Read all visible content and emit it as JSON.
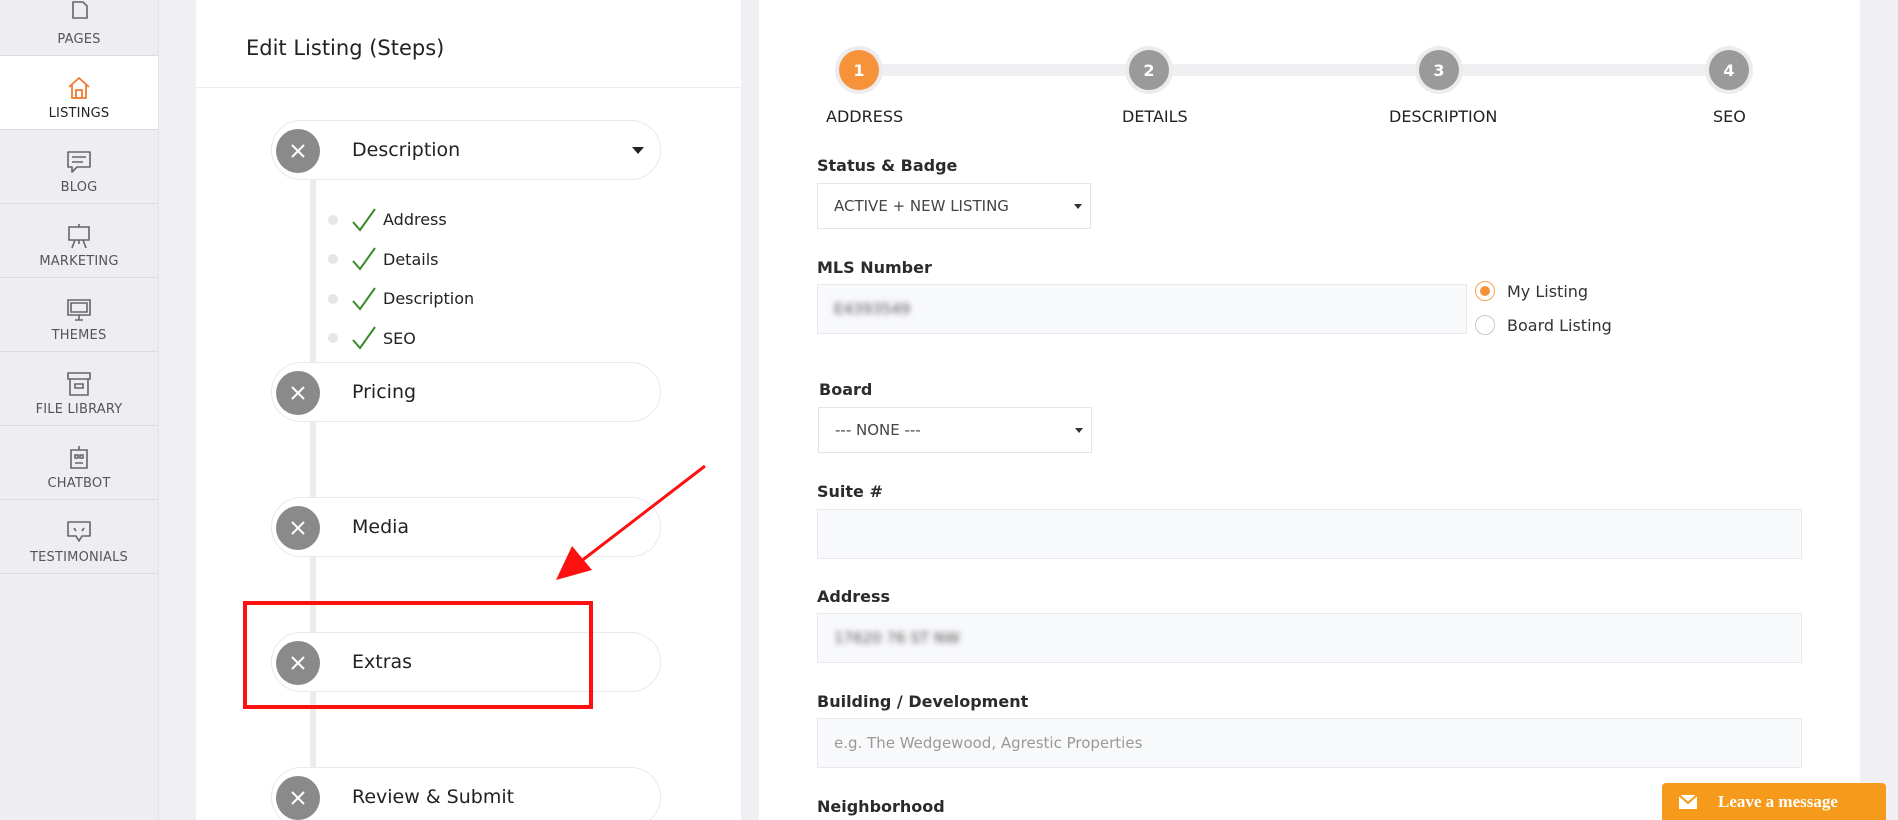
{
  "sidebar": {
    "items": [
      {
        "label": "PAGES",
        "icon": "page-icon"
      },
      {
        "label": "LISTINGS",
        "icon": "house-icon",
        "active": true
      },
      {
        "label": "BLOG",
        "icon": "comment-icon"
      },
      {
        "label": "MARKETING",
        "icon": "easel-icon"
      },
      {
        "label": "THEMES",
        "icon": "monitor-icon"
      },
      {
        "label": "FILE LIBRARY",
        "icon": "archive-icon"
      },
      {
        "label": "CHATBOT",
        "icon": "robot-icon"
      },
      {
        "label": "TESTIMONIALS",
        "icon": "testimonial-icon"
      }
    ],
    "accent_color": "#f07a2e"
  },
  "steps_panel": {
    "title": "Edit Listing (Steps)",
    "steps": [
      {
        "label": "Description"
      },
      {
        "label": "Pricing"
      },
      {
        "label": "Media"
      },
      {
        "label": "Extras"
      },
      {
        "label": "Review & Submit"
      }
    ],
    "description_substeps": [
      {
        "label": "Address"
      },
      {
        "label": "Details"
      },
      {
        "label": "Description"
      },
      {
        "label": "SEO"
      }
    ]
  },
  "wizard": {
    "steps": [
      {
        "number": "1",
        "label": "ADDRESS",
        "active": true
      },
      {
        "number": "2",
        "label": "DETAILS"
      },
      {
        "number": "3",
        "label": "DESCRIPTION"
      },
      {
        "number": "4",
        "label": "SEO"
      }
    ],
    "active_color": "#f5923a"
  },
  "form": {
    "status_badge": {
      "label": "Status & Badge",
      "value": "ACTIVE + NEW LISTING"
    },
    "mls_number": {
      "label": "MLS Number",
      "value": "E4393549"
    },
    "listing_type": {
      "options": [
        "My Listing",
        "Board Listing"
      ],
      "selected": "My Listing"
    },
    "board": {
      "label": "Board",
      "value": "--- NONE ---"
    },
    "suite": {
      "label": "Suite #",
      "value": ""
    },
    "address": {
      "label": "Address",
      "value": "17620 76 ST NW"
    },
    "building": {
      "label": "Building / Development",
      "placeholder": "e.g. The Wedgewood, Agrestic Properties"
    },
    "neighborhood": {
      "label": "Neighborhood"
    }
  },
  "chat": {
    "label": "Leave a message",
    "color": "#f59a1a"
  },
  "annotation": {
    "color": "#ff1010"
  }
}
